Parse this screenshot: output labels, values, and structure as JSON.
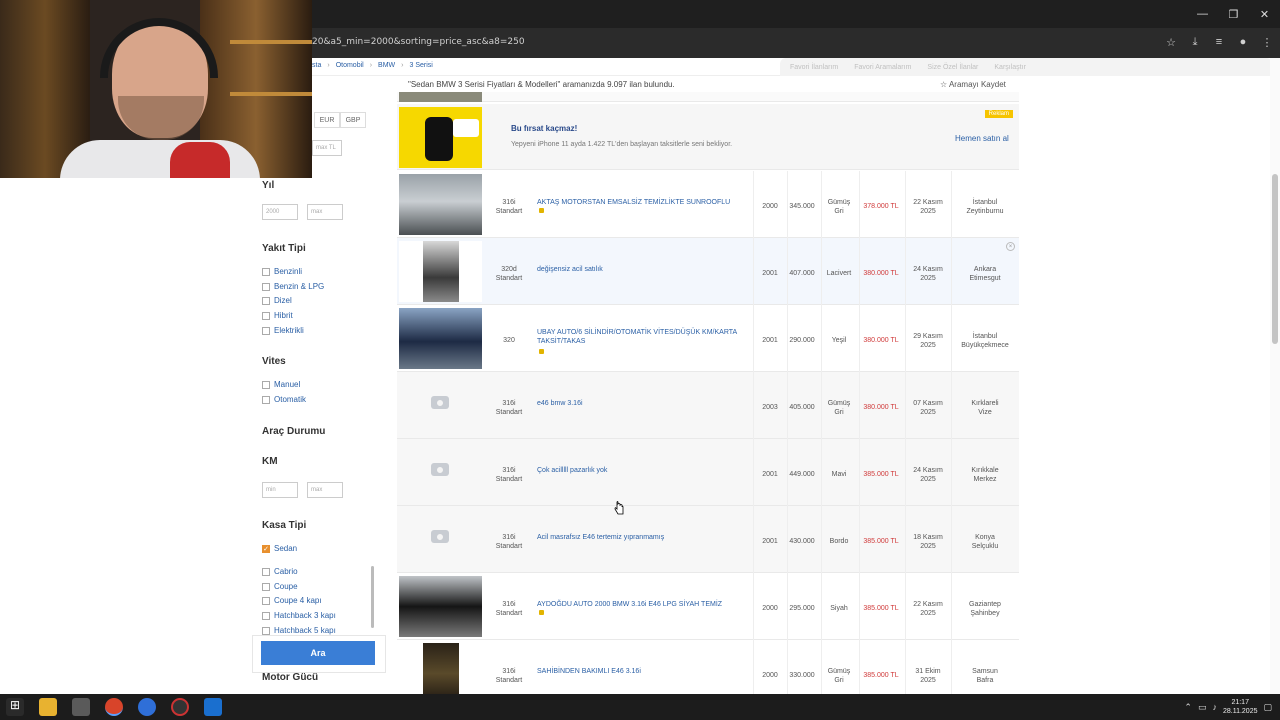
{
  "browser": {
    "url": "20&a5_min=2000&sorting=price_asc&a8=250",
    "window_controls": [
      "—",
      "❐",
      "✕"
    ],
    "icons": [
      "star-icon",
      "download-icon",
      "menu-list-icon",
      "profile-icon",
      "more-icon"
    ]
  },
  "breadcrumb": {
    "items": [
      "sta",
      "Otomobil",
      "BMW",
      "3 Serisi"
    ]
  },
  "top_links": [
    "Favori İlanlarım",
    "Favori Aramalarım",
    "Size Özel İlanlar",
    "Karşılaştır"
  ],
  "results": {
    "info": "\"Sedan BMW 3 Serisi Fiyatları & Modelleri\" aramanızda 9.097 ilan bulundu.",
    "save_search": "Aramayı Kaydet"
  },
  "sidebar": {
    "currencies": [
      "EUR",
      "GBP"
    ],
    "price_max_placeholder": "max TL",
    "year": {
      "title": "Yıl",
      "min": "2000",
      "max": "max"
    },
    "fuel": {
      "title": "Yakıt Tipi",
      "options": [
        "Benzinli",
        "Benzin & LPG",
        "Dizel",
        "Hibrit",
        "Elektrikli"
      ]
    },
    "gear": {
      "title": "Vites",
      "options": [
        "Manuel",
        "Otomatik"
      ]
    },
    "condition": {
      "title": "Araç Durumu"
    },
    "km": {
      "title": "KM",
      "min": "min",
      "max": "max"
    },
    "body": {
      "title": "Kasa Tipi",
      "selected": "Sedan",
      "options": [
        "Cabrio",
        "Coupe",
        "Coupe 4 kapı",
        "Hatchback 3 kapı",
        "Hatchback 5 kapı"
      ]
    },
    "engine_power": {
      "title": "Motor Gücü"
    },
    "search_button": "Ara"
  },
  "promo": {
    "title": "Bu fırsat kaçmaz!",
    "text": "Yepyeni iPhone 11 ayda 1.422 TL'den başlayan taksitlerle seni bekliyor.",
    "badge": "Reklam",
    "link": "Hemen satın al"
  },
  "listings": [
    {
      "model": "316i\nStandart",
      "title": "AKTAŞ MOTORSTAN EMSALSİZ TEMİZLİKTE SUNROOFLU",
      "year": "2000",
      "km": "345.000",
      "color": "Gümüş\nGri",
      "price": "378.000 TL",
      "date": "22 Kasım\n2025",
      "location": "İstanbul\nZeytinburnu",
      "photo": "silver",
      "note": true
    },
    {
      "model": "320d\nStandart",
      "title": "değişensiz acil satılık",
      "year": "2001",
      "km": "407.000",
      "color": "Lacivert",
      "price": "380.000 TL",
      "date": "24 Kasım\n2025",
      "location": "Ankara\nEtimesgut",
      "photo": "dark-vertical",
      "note": false
    },
    {
      "model": "320",
      "title": "UBAY AUTO/6 SİLİNDİR/OTOMATİK VİTES/DÜŞÜK KM/KARTA TAKSİT/TAKAS",
      "year": "2001",
      "km": "290.000",
      "color": "Yeşil",
      "price": "380.000 TL",
      "date": "29 Kasım\n2025",
      "location": "İstanbul\nBüyükçekmece",
      "photo": "blue",
      "note": true
    },
    {
      "model": "316i\nStandart",
      "title": "e46 bmw 3.16i",
      "year": "2003",
      "km": "405.000",
      "color": "Gümüş\nGri",
      "price": "380.000 TL",
      "date": "07 Kasım\n2025",
      "location": "Kırklareli\nVize",
      "photo": "none",
      "note": false
    },
    {
      "model": "316i\nStandart",
      "title": "Çok acilllll pazarlık yok",
      "year": "2001",
      "km": "449.000",
      "color": "Mavi",
      "price": "385.000 TL",
      "date": "24 Kasım\n2025",
      "location": "Kırıkkale\nMerkez",
      "photo": "none",
      "note": false
    },
    {
      "model": "316i\nStandart",
      "title": "Acil masrafsız E46 tertemiz yıpranmamış",
      "year": "2001",
      "km": "430.000",
      "color": "Bordo",
      "price": "385.000 TL",
      "date": "18 Kasım\n2025",
      "location": "Konya\nSelçuklu",
      "photo": "none",
      "note": false
    },
    {
      "model": "316i\nStandart",
      "title": "AYDOĞDU AUTO 2000 BMW 3.16i E46 LPG SİYAH TEMİZ",
      "year": "2000",
      "km": "295.000",
      "color": "Siyah",
      "price": "385.000 TL",
      "date": "22 Kasım\n2025",
      "location": "Gaziantep\nŞahinbey",
      "photo": "black",
      "note": true
    },
    {
      "model": "316i\nStandart",
      "title": "SAHİBİNDEN BAKIMLI E46 3.16i",
      "year": "2000",
      "km": "330.000",
      "color": "Gümüş\nGri",
      "price": "385.000 TL",
      "date": "31 Ekim\n2025",
      "location": "Samsun\nBafra",
      "photo": "night",
      "note": false
    }
  ],
  "taskbar": {
    "time": "21:17",
    "date": "28.11.2025"
  }
}
